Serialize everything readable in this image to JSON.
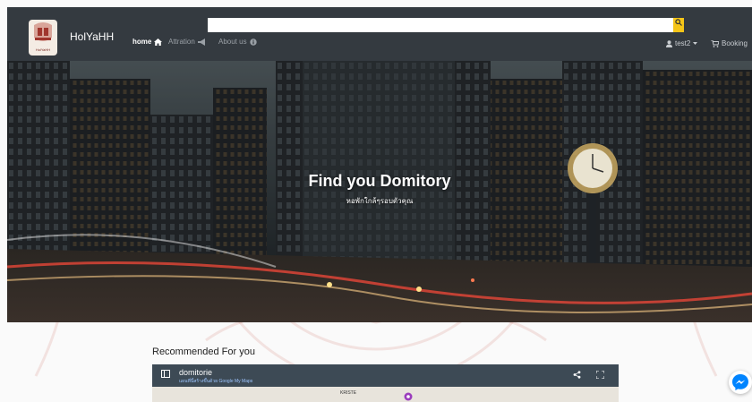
{
  "navbar": {
    "brand": "HolYaHH",
    "logo_caption": "HolYaHH",
    "search": {
      "value": "",
      "placeholder": ""
    },
    "links": [
      {
        "label": "home",
        "icon": "home-icon",
        "active": true
      },
      {
        "label": "Attration",
        "icon": "megaphone-icon",
        "active": false
      },
      {
        "label": "About us",
        "icon": "info-icon",
        "active": false
      }
    ],
    "user_label": "test2",
    "booking_label": "Booking"
  },
  "hero": {
    "title": "Find you Domitory",
    "subtitle": "หอพักใกล้ๆรอบตัวคุณ"
  },
  "recommended": {
    "title": "Recommended For you"
  },
  "map": {
    "title": "domitorie",
    "description": "แผนที่นี้สร้างขึ้นด้วย Google My Maps",
    "place_label": "KRISTE"
  },
  "colors": {
    "navbar_bg": "#343a40",
    "search_button": "#f5c518",
    "map_header": "#3d4a55",
    "messenger": "#0084ff"
  }
}
